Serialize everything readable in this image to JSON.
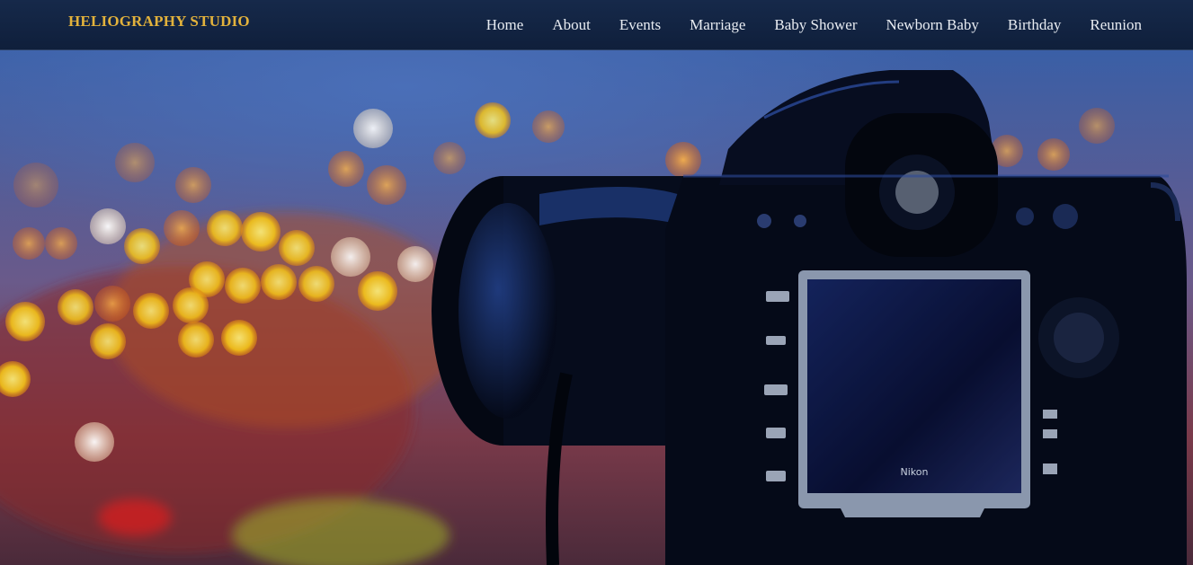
{
  "header": {
    "brand": "HELIOGRAPHY STUDIO",
    "nav": [
      {
        "label": "Home"
      },
      {
        "label": "About"
      },
      {
        "label": "Events"
      },
      {
        "label": "Marriage"
      },
      {
        "label": "Baby Shower"
      },
      {
        "label": "Newborn Baby"
      },
      {
        "label": "Birthday"
      },
      {
        "label": "Reunion"
      }
    ]
  },
  "hero": {
    "camera_badge": "Nikon"
  },
  "colors": {
    "brand": "#e2b23c",
    "nav_bg": "#13264a",
    "nav_text": "#e8ecf2"
  }
}
